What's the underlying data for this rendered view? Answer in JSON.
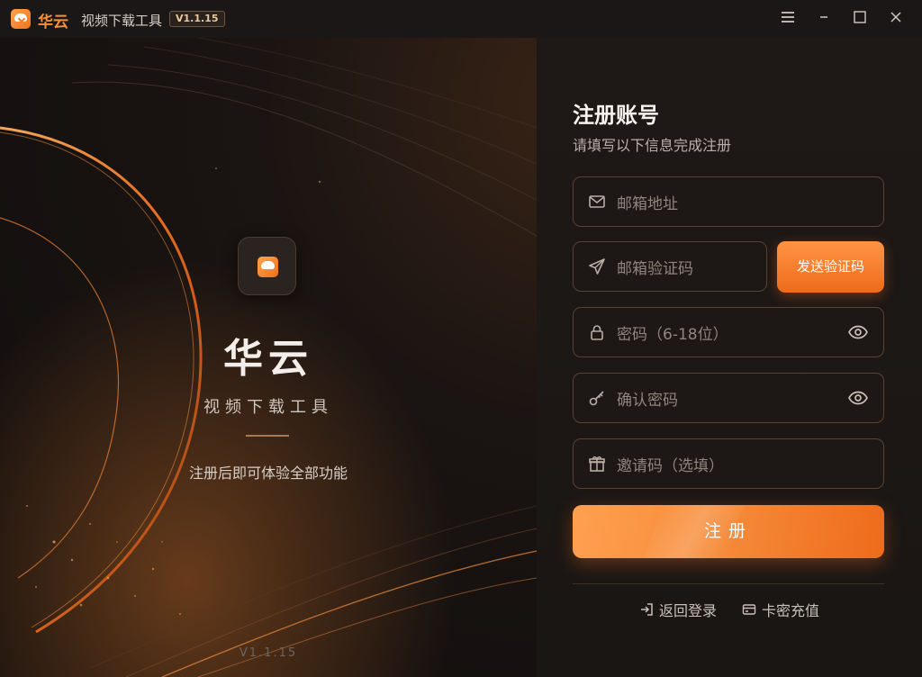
{
  "titlebar": {
    "app_name": "华云",
    "app_subtitle": "视频下载工具",
    "version": "V1.1.15",
    "icons": [
      "menu-icon",
      "minimize-icon",
      "maximize-icon",
      "close-icon"
    ]
  },
  "brand": {
    "title": "华云",
    "subtitle": "视频下载工具",
    "description": "注册后即可体验全部功能",
    "version": "V1.1.15"
  },
  "form": {
    "title": "注册账号",
    "subtitle": "请填写以下信息完成注册",
    "email_placeholder": "邮箱地址",
    "code_placeholder": "邮箱验证码",
    "send_code_label": "发送验证码",
    "password_placeholder": "密码（6-18位）",
    "confirm_placeholder": "确认密码",
    "invite_placeholder": "邀请码（选填）",
    "submit_label": "注册",
    "back_login_label": "返回登录",
    "recharge_label": "卡密充值"
  },
  "colors": {
    "accent": "#f58a38",
    "accent_dark": "#ee6b1b",
    "background": "#141110"
  }
}
